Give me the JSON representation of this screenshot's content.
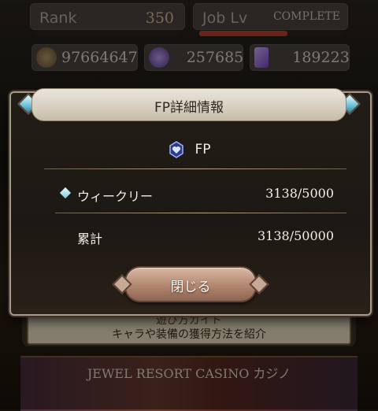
{
  "background": {
    "rank_label": "Rank",
    "rank_value": "350",
    "joblv_label": "Job Lv",
    "joblv_status": "COMPLETE",
    "resources": [
      {
        "icon": "rupie-coin-icon",
        "value": "97664647"
      },
      {
        "icon": "crystal-points-icon",
        "value": "257685"
      },
      {
        "icon": "crystal-shard-icon",
        "value": "189223"
      }
    ],
    "banner_line1": "遊び方ガイド",
    "banner_line2": "キャラや装備の獲得方法を紹介",
    "casino_label": "JEWEL RESORT CASINO カジノ"
  },
  "dialog": {
    "title": "FP詳細情報",
    "section_label": "FP",
    "section_icon": "fp-heart-crystal-icon",
    "rows": [
      {
        "label": "ウィークリー",
        "value": "3138/5000",
        "icon": "diamond-bullet-icon"
      },
      {
        "label": "累計",
        "value": "3138/50000"
      }
    ],
    "close_label": "閉じる"
  },
  "colors": {
    "accent_gem": "#6bc0d8",
    "button": "#b58a73",
    "title_bar": "#d8d1c3",
    "jobbar_fill": "#c0432a"
  }
}
